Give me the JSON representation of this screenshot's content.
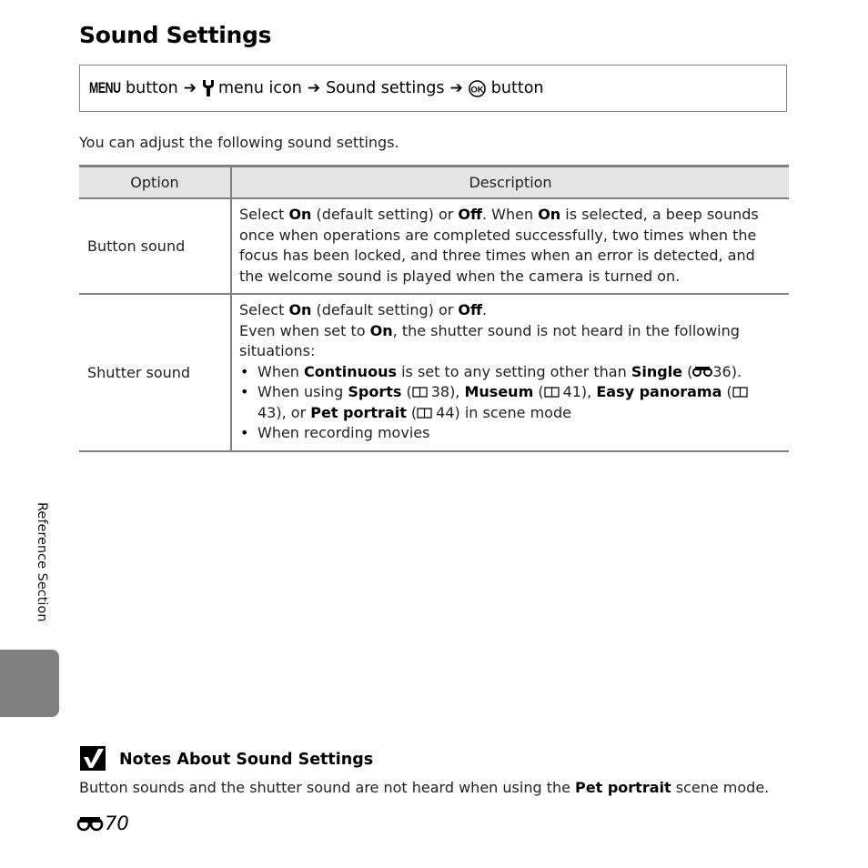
{
  "page_title": "Sound Settings",
  "nav_path": {
    "menu_label": "MENU",
    "step1": "button",
    "step2": "menu icon",
    "step3": "Sound settings",
    "step4": "button",
    "arrow": "➔",
    "icons": [
      "menu-button-glyph",
      "wrench-icon",
      "ok-button-icon"
    ]
  },
  "intro": "You can adjust the following sound settings.",
  "table": {
    "headers": {
      "option": "Option",
      "description": "Description"
    },
    "rows": [
      {
        "option": "Button sound",
        "desc": {
          "t1": "Select ",
          "b1": "On",
          "t2": " (default setting) or ",
          "b2": "Off",
          "t3": ". When ",
          "b3": "On",
          "t4": " is selected, a beep sounds once when operations are completed successfully, two times when the focus has been locked, and three times when an error is detected, and the welcome sound is played when the camera is turned on."
        }
      },
      {
        "option": "Shutter sound",
        "desc": {
          "l1_t1": "Select ",
          "l1_b1": "On",
          "l1_t2": " (default setting) or ",
          "l1_b2": "Off",
          "l1_t3": ".",
          "l2_t1": "Even when set to ",
          "l2_b1": "On",
          "l2_t2": ", the shutter sound is not heard in the following situations:",
          "bullets": [
            {
              "t1": "When ",
              "b1": "Continuous",
              "t2": " is set to any setting other than ",
              "b2": "Single",
              "t3": " (",
              "ref": "36",
              "t4": ")."
            },
            {
              "t1": "When using ",
              "b1": "Sports",
              "r1": "38",
              "b2": "Museum",
              "r2": "41",
              "b3": "Easy panorama",
              "r3": "43",
              "t_or": "or ",
              "b4": "Pet portrait",
              "r4": "44",
              "t_end": ") in scene mode"
            },
            {
              "t1": "When recording movies"
            }
          ]
        }
      }
    ]
  },
  "side_tab": {
    "label": "Reference Section",
    "color": "#808080"
  },
  "note": {
    "icon": "checkmark-icon",
    "title": "Notes About Sound Settings",
    "t1": "Button sounds and the shutter sound are not heard when using the ",
    "b1": "Pet portrait",
    "t2": " scene mode."
  },
  "page_number": "70"
}
